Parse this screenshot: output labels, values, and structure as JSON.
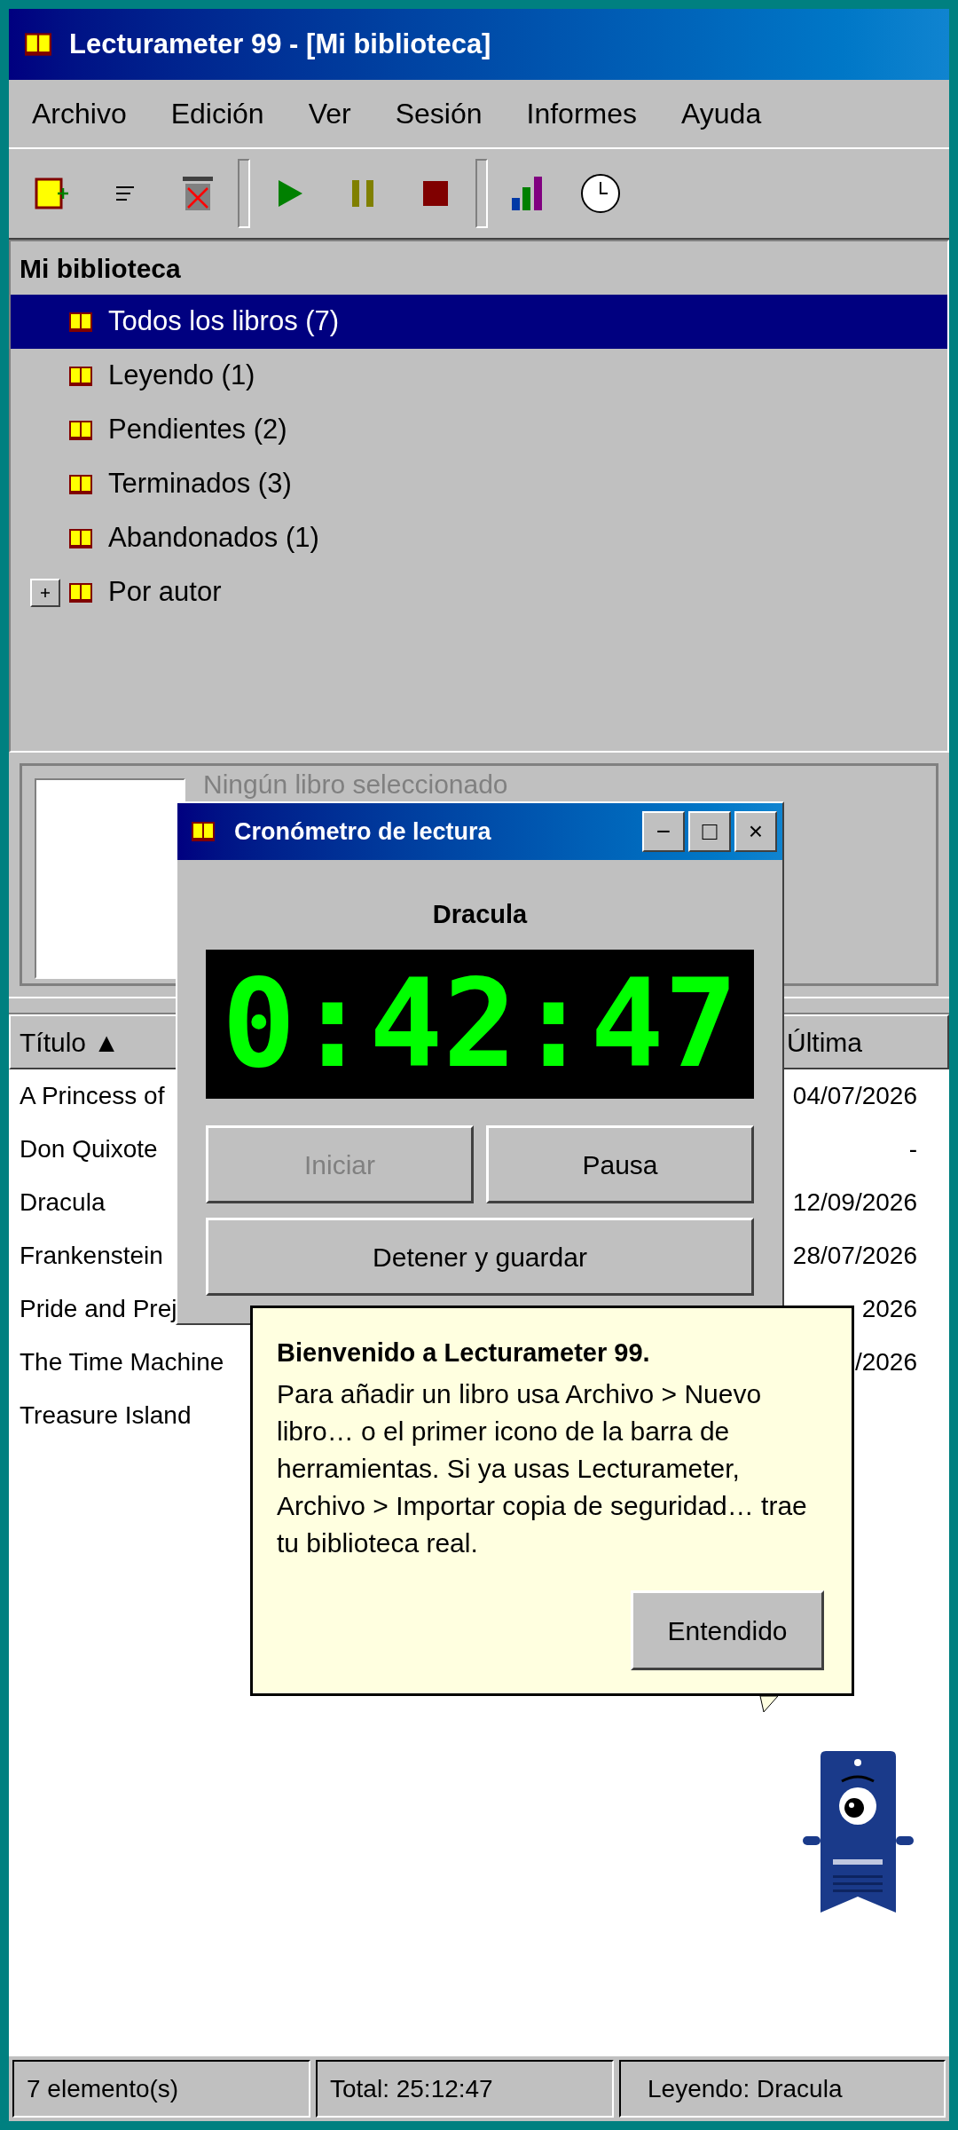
{
  "window": {
    "title": "Lecturameter 99 - [Mi biblioteca]"
  },
  "menu": [
    "Archivo",
    "Edición",
    "Ver",
    "Sesión",
    "Informes",
    "Ayuda"
  ],
  "toolbar": [
    {
      "kind": "new-book"
    },
    {
      "kind": "lines"
    },
    {
      "kind": "trash"
    },
    {
      "kind": "separator"
    },
    {
      "kind": "play"
    },
    {
      "kind": "pause"
    },
    {
      "kind": "stop"
    },
    {
      "kind": "separator"
    },
    {
      "kind": "chart"
    },
    {
      "kind": "clock"
    }
  ],
  "tree": {
    "title": "Mi biblioteca",
    "items": [
      {
        "label": "Todos los libros (7)",
        "selected": true
      },
      {
        "label": "Leyendo (1)",
        "selected": false
      },
      {
        "label": "Pendientes (2)",
        "selected": false
      },
      {
        "label": "Terminados (3)",
        "selected": false
      },
      {
        "label": "Abandonados (1)",
        "selected": false
      },
      {
        "label": "Por autor",
        "selected": false,
        "expanded": false
      }
    ]
  },
  "details": {
    "message": "Ningún libro seleccionado"
  },
  "list": {
    "columns": [
      {
        "label": "Título ▲"
      },
      {
        "label": "Última"
      }
    ],
    "rows": [
      {
        "title": "A Princess of",
        "last": "04/07/2026"
      },
      {
        "title": "Don Quixote",
        "last": "-"
      },
      {
        "title": "Dracula",
        "last": "12/09/2026"
      },
      {
        "title": "Frankenstein",
        "last": "28/07/2026"
      },
      {
        "title": "Pride and Prej",
        "last": "2026"
      },
      {
        "title": "The Time Machine",
        "last": "/2026"
      },
      {
        "title": "Treasure Island"
      }
    ]
  },
  "timer_dialog": {
    "title": "Cronómetro de lectura",
    "controls": [
      "−",
      "□",
      "×"
    ],
    "book": "Dracula",
    "time": "0:42:47",
    "buttons": [
      {
        "label": "Iniciar",
        "disabled": true
      },
      {
        "label": "Pausa",
        "disabled": false
      },
      {
        "label": "Detener y guardar",
        "disabled": false
      }
    ]
  },
  "tip": {
    "title": "Bienvenido a Lecturameter 99.",
    "body": "Para añadir un libro usa Archivo > Nuevo libro… o el primer icono de la barra de herramientas. Si ya usas Lecturameter, Archivo > Importar copia de seguridad… trae tu biblioteca real.",
    "button": "Entendido"
  },
  "status_bar": [
    "7 elemento(s)",
    "Total: 25:12:47",
    "Leyendo: Dracula"
  ]
}
